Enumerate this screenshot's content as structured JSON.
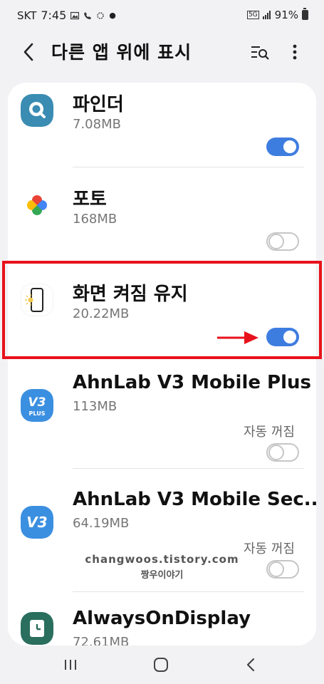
{
  "status": {
    "carrier": "SKT",
    "time": "7:45",
    "network": "5G",
    "battery": "91%"
  },
  "header": {
    "title": "다른 앱 위에 표시"
  },
  "apps": [
    {
      "name": "파인더",
      "size": "7.08MB",
      "enabled": true,
      "icon": "finder-icon"
    },
    {
      "name": "포토",
      "size": "168MB",
      "enabled": false,
      "icon": "photos-icon"
    },
    {
      "name": "화면 켜짐 유지",
      "size": "20.22MB",
      "enabled": true,
      "icon": "screen-on-icon"
    },
    {
      "name": "AhnLab V3 Mobile Plus",
      "size": "113MB",
      "enabled": false,
      "auto_off": "자동 꺼짐",
      "icon": "v3-plus-icon"
    },
    {
      "name": "AhnLab V3 Mobile Sec..",
      "size": "64.19MB",
      "enabled": false,
      "auto_off": "자동 꺼짐",
      "icon": "v3-security-icon"
    },
    {
      "name": "AlwaysOnDisplay",
      "size": "72.61MB",
      "icon": "aod-icon"
    }
  ],
  "watermark": {
    "line1": "changwoos.tistory.com",
    "line2": "짱우이야기"
  },
  "icon_labels": {
    "plus": "PLUS"
  },
  "colors": {
    "accent": "#3e7de0",
    "highlight": "#e8121b"
  }
}
